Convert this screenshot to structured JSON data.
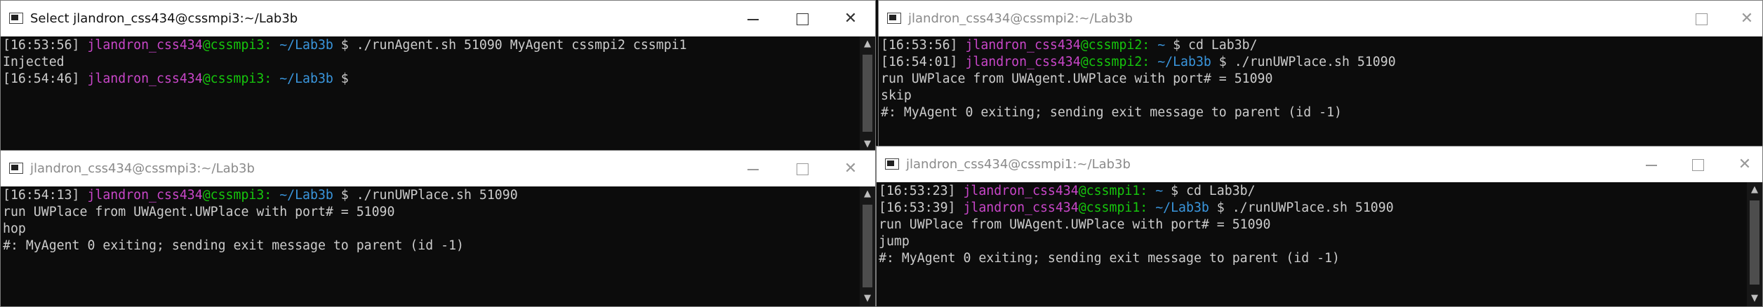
{
  "windows": {
    "mpi3_agent": {
      "title": "Select jlandron_css434@cssmpi3:~/Lab3b",
      "lines": [
        [
          [
            "[16:53:56] ",
            "white"
          ],
          [
            "jlandron_css434",
            "user"
          ],
          [
            "@cssmpi3: ",
            "host"
          ],
          [
            "~/Lab3b",
            "path"
          ],
          [
            " $ ./runAgent.sh 51090 MyAgent cssmpi2 cssmpi1",
            "white"
          ]
        ],
        [
          [
            "Injected",
            "white"
          ]
        ],
        [
          [
            "[16:54:46] ",
            "white"
          ],
          [
            "jlandron_css434",
            "user"
          ],
          [
            "@cssmpi3: ",
            "host"
          ],
          [
            "~/Lab3b",
            "path"
          ],
          [
            " $",
            "white"
          ]
        ]
      ]
    },
    "mpi2_place": {
      "title": "jlandron_css434@cssmpi2:~/Lab3b",
      "lines": [
        [
          [
            "[16:53:56] ",
            "white"
          ],
          [
            "jlandron_css434",
            "user"
          ],
          [
            "@cssmpi2: ",
            "host"
          ],
          [
            "~",
            "path"
          ],
          [
            " $ cd Lab3b/",
            "white"
          ]
        ],
        [
          [
            "[16:54:01] ",
            "white"
          ],
          [
            "jlandron_css434",
            "user"
          ],
          [
            "@cssmpi2: ",
            "host"
          ],
          [
            "~/Lab3b",
            "path"
          ],
          [
            " $ ./runUWPlace.sh 51090",
            "white"
          ]
        ],
        [
          [
            "run UWPlace from UWAgent.UWPlace with port# = 51090",
            "white"
          ]
        ],
        [
          [
            "skip",
            "white"
          ]
        ],
        [
          [
            "#: MyAgent 0 exiting; sending exit message to parent (id -1)",
            "white"
          ]
        ]
      ]
    },
    "mpi3_place": {
      "title": "jlandron_css434@cssmpi3:~/Lab3b",
      "lines": [
        [
          [
            "[16:54:13] ",
            "white"
          ],
          [
            "jlandron_css434",
            "user"
          ],
          [
            "@cssmpi3: ",
            "host"
          ],
          [
            "~/Lab3b",
            "path"
          ],
          [
            " $ ./runUWPlace.sh 51090",
            "white"
          ]
        ],
        [
          [
            "run UWPlace from UWAgent.UWPlace with port# = 51090",
            "white"
          ]
        ],
        [
          [
            "hop",
            "white"
          ]
        ],
        [
          [
            "#: MyAgent 0 exiting; sending exit message to parent (id -1)",
            "white"
          ]
        ]
      ]
    },
    "mpi1_place": {
      "title": "jlandron_css434@cssmpi1:~/Lab3b",
      "lines": [
        [
          [
            "[16:53:23] ",
            "white"
          ],
          [
            "jlandron_css434",
            "user"
          ],
          [
            "@cssmpi1: ",
            "host"
          ],
          [
            "~",
            "path"
          ],
          [
            " $ cd Lab3b/",
            "white"
          ]
        ],
        [
          [
            "[16:53:39] ",
            "white"
          ],
          [
            "jlandron_css434",
            "user"
          ],
          [
            "@cssmpi1: ",
            "host"
          ],
          [
            "~/Lab3b",
            "path"
          ],
          [
            " $ ./runUWPlace.sh 51090",
            "white"
          ]
        ],
        [
          [
            "run UWPlace from UWAgent.UWPlace with port# = 51090",
            "white"
          ]
        ],
        [
          [
            "jump",
            "white"
          ]
        ],
        [
          [
            "#: MyAgent 0 exiting; sending exit message to parent (id -1)",
            "white"
          ]
        ]
      ]
    }
  },
  "controls": {
    "minimize": "—",
    "close": "✕"
  },
  "scrollbar": {
    "up": "▲",
    "down": "▼"
  },
  "colors": {
    "user": "#c846c8",
    "host": "#16c60c",
    "path": "#3a96dd",
    "text": "#cccccc",
    "background": "#0c0c0c"
  }
}
